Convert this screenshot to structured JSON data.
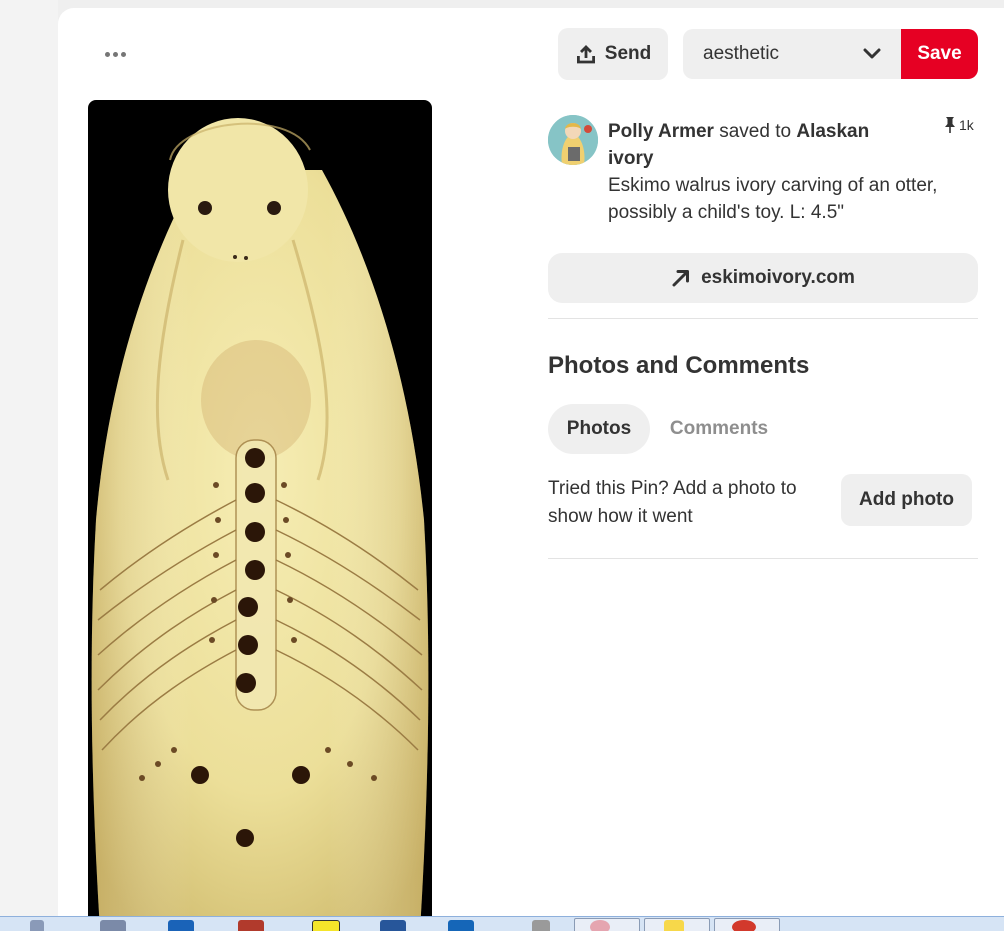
{
  "toolbar": {
    "more_icon": "more-horizontal-icon",
    "send_label": "Send",
    "send_icon": "upload-icon",
    "board_value": "aesthetic",
    "board_icon": "chevron-down-icon",
    "save_label": "Save",
    "save_color": "#e60023"
  },
  "pin": {
    "image_icon": "walrus-ivory-otter-carving",
    "user_name": "Polly Armer",
    "saved_to_text": " saved to ",
    "board_name": "Alaskan ivory",
    "pin_count": "1k",
    "pin_icon": "pushpin-icon",
    "description": "Eskimo walrus ivory carving of an otter, possibly a child's toy. L: 4.5\"",
    "link_text": "eskimoivory.com",
    "link_icon": "arrow-up-right-icon"
  },
  "photos_comments": {
    "title": "Photos and Comments",
    "tabs": [
      {
        "label": "Photos",
        "active": true
      },
      {
        "label": "Comments",
        "active": false
      }
    ],
    "tried_text": "Tried this Pin? Add a photo to show how it went",
    "add_photo_label": "Add photo"
  },
  "colors": {
    "accent": "#e60023",
    "button_bg": "#efefef",
    "taskbar_bg": "#d6e4f5"
  }
}
